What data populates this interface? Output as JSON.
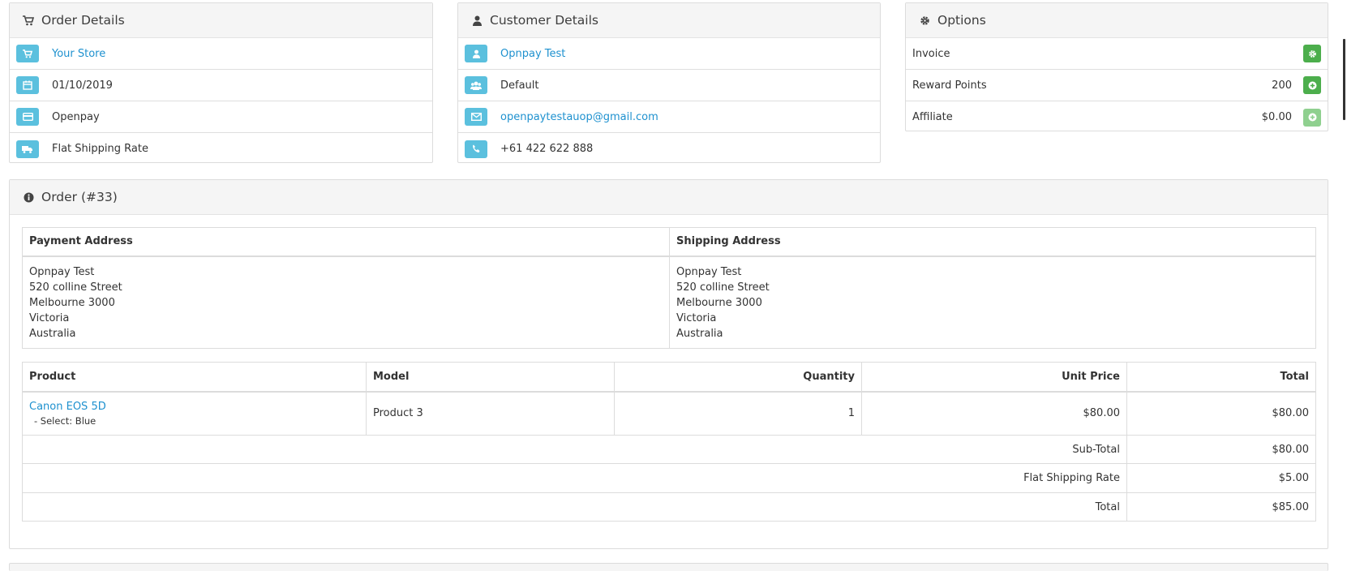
{
  "order_details": {
    "title": "Order Details",
    "store": "Your Store",
    "date": "01/10/2019",
    "payment_method": "Openpay",
    "shipping_method": "Flat Shipping Rate"
  },
  "customer_details": {
    "title": "Customer Details",
    "name": "Opnpay Test",
    "group": "Default",
    "email": "openpaytestauop@gmail.com",
    "phone": "+61 422 622 888"
  },
  "options": {
    "title": "Options",
    "rows": [
      {
        "label": "Invoice",
        "value": ""
      },
      {
        "label": "Reward Points",
        "value": "200"
      },
      {
        "label": "Affiliate",
        "value": "$0.00"
      }
    ]
  },
  "order": {
    "title": "Order (#33)",
    "payment_address_header": "Payment Address",
    "shipping_address_header": "Shipping Address",
    "payment_address": [
      "Opnpay Test",
      "520 colline Street",
      "Melbourne 3000",
      "Victoria",
      "Australia"
    ],
    "shipping_address": [
      "Opnpay Test",
      "520 colline Street",
      "Melbourne 3000",
      "Victoria",
      "Australia"
    ],
    "columns": [
      "Product",
      "Model",
      "Quantity",
      "Unit Price",
      "Total"
    ],
    "product": {
      "name": "Canon EOS 5D",
      "option": "- Select: Blue",
      "model": "Product 3",
      "quantity": "1",
      "unit_price": "$80.00",
      "total": "$80.00"
    },
    "totals": [
      {
        "label": "Sub-Total",
        "value": "$80.00"
      },
      {
        "label": "Flat Shipping Rate",
        "value": "$5.00"
      },
      {
        "label": "Total",
        "value": "$85.00"
      }
    ]
  },
  "colors": {
    "info_badge": "#5bc0de",
    "success_button": "#4cae4c",
    "link": "#1e91cf"
  }
}
